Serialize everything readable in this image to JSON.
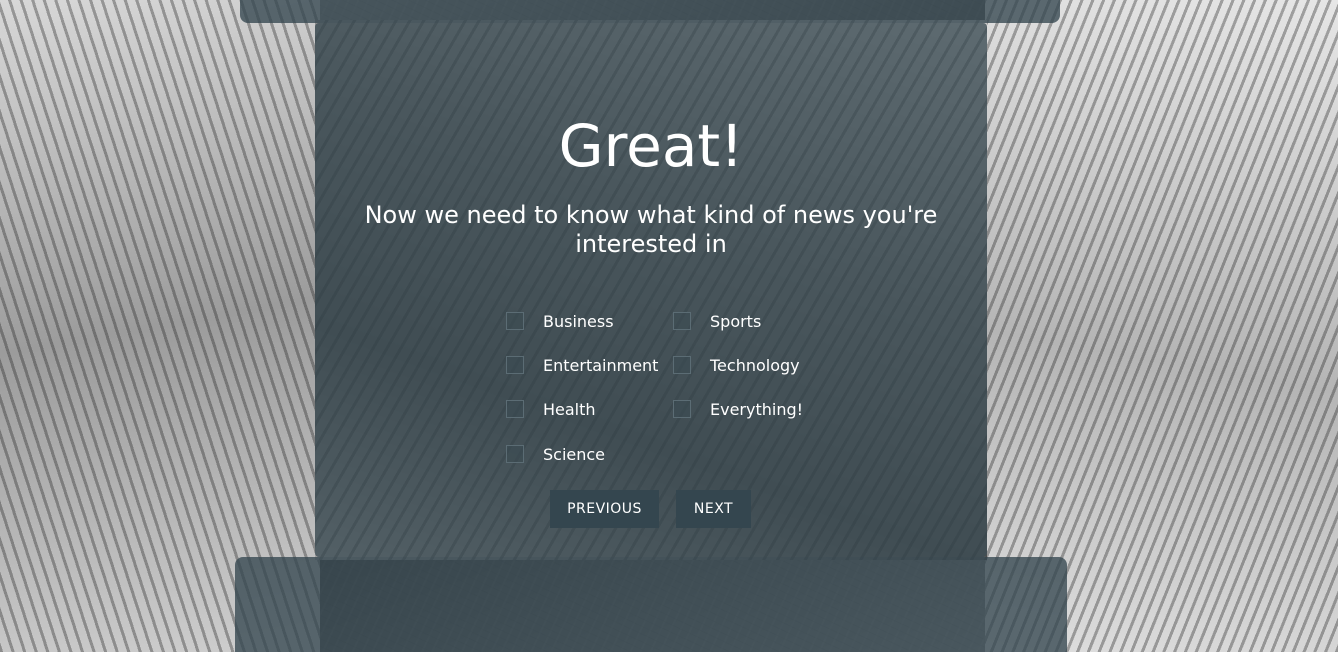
{
  "page": {
    "title": "Great!",
    "subtitle": "Now we need to know what kind of news you're interested in"
  },
  "categories": {
    "left": [
      {
        "label": "Business",
        "checked": false
      },
      {
        "label": "Entertainment",
        "checked": false
      },
      {
        "label": "Health",
        "checked": false
      },
      {
        "label": "Science",
        "checked": false
      }
    ],
    "right": [
      {
        "label": "Sports",
        "checked": false
      },
      {
        "label": "Technology",
        "checked": false
      },
      {
        "label": "Everything!",
        "checked": false
      }
    ]
  },
  "buttons": {
    "previous_label": "PREVIOUS",
    "next_label": "NEXT"
  },
  "colors": {
    "panel": "#34464f",
    "text": "#ffffff",
    "checkbox_border": "#5b6c74"
  }
}
